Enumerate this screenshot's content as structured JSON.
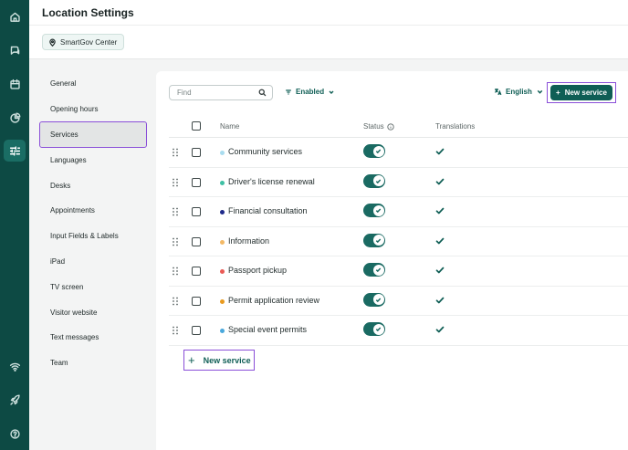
{
  "rail": {
    "icons": [
      "home-icon",
      "chat-icon",
      "calendar-icon",
      "pie-chart-icon",
      "sliders-icon",
      "wifi-icon",
      "rocket-icon",
      "help-icon"
    ],
    "active": "sliders-icon"
  },
  "header": {
    "title": "Location Settings",
    "location_chip": "SmartGov Center"
  },
  "subnav": {
    "items": [
      "General",
      "Opening hours",
      "Services",
      "Languages",
      "Desks",
      "Appointments",
      "Input Fields & Labels",
      "iPad",
      "TV screen",
      "Visitor website",
      "Text messages",
      "Team"
    ],
    "active": "Services"
  },
  "toolbar": {
    "search_placeholder": "Find",
    "filter_label": "Enabled",
    "language_label": "English",
    "new_service_label": "New service"
  },
  "table": {
    "columns": [
      "Name",
      "Status",
      "Translations"
    ],
    "rows": [
      {
        "name": "Community services",
        "dot_color": "#a9dcef",
        "enabled": true,
        "translated": true
      },
      {
        "name": "Driver's license renewal",
        "dot_color": "#3fc0a4",
        "enabled": true,
        "translated": true
      },
      {
        "name": "Financial consultation",
        "dot_color": "#1f2a8a",
        "enabled": true,
        "translated": true
      },
      {
        "name": "Information",
        "dot_color": "#f3b966",
        "enabled": true,
        "translated": true
      },
      {
        "name": "Passport pickup",
        "dot_color": "#ea5a55",
        "enabled": true,
        "translated": true
      },
      {
        "name": "Permit application review",
        "dot_color": "#e99a1e",
        "enabled": true,
        "translated": true
      },
      {
        "name": "Special event permits",
        "dot_color": "#4aa8dc",
        "enabled": true,
        "translated": true
      }
    ]
  },
  "footer": {
    "new_service_label": "New service"
  },
  "colors": {
    "rail": "#0d4a44",
    "primary": "#0f5e55",
    "highlight": "#8a4fd8"
  }
}
